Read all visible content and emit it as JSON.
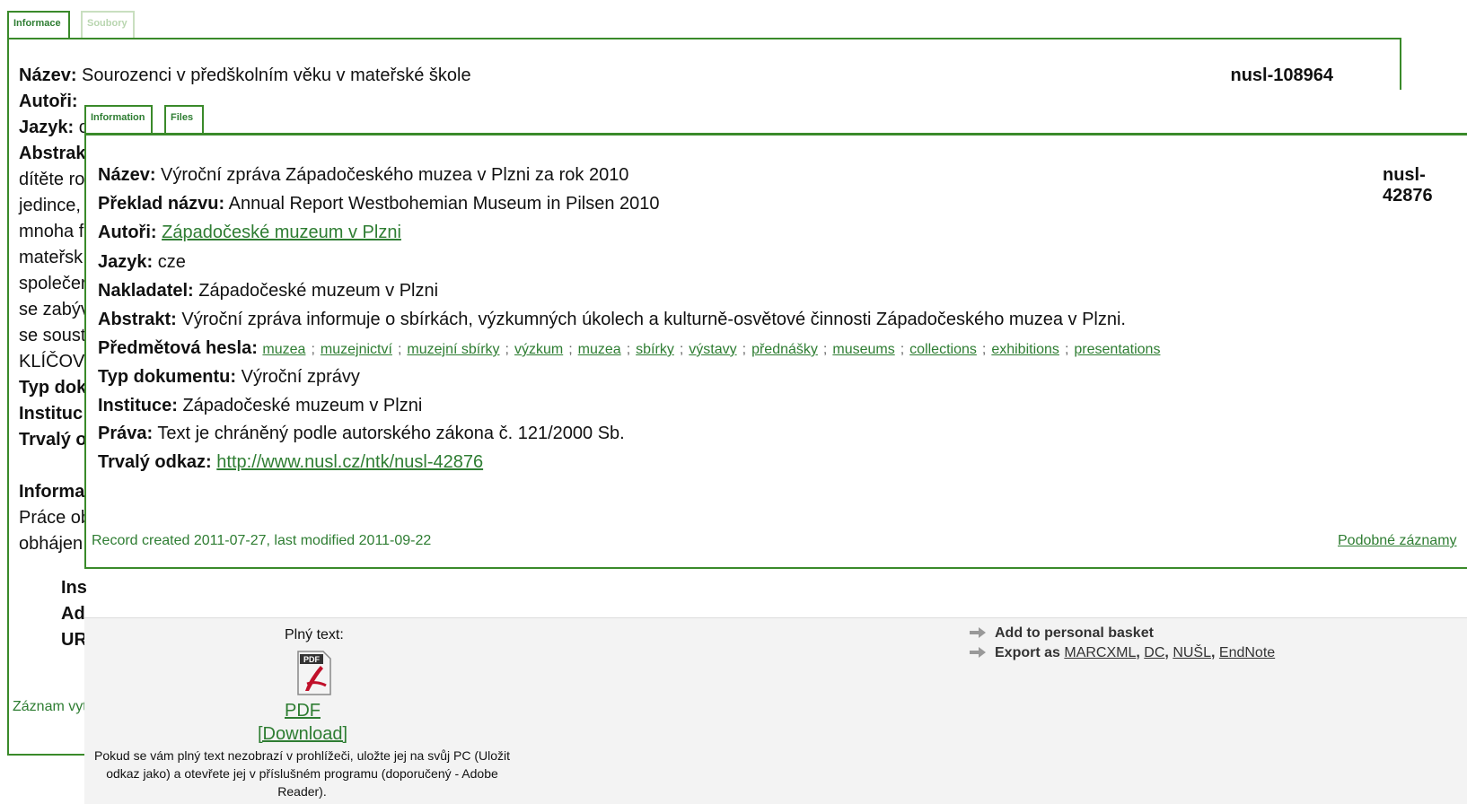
{
  "back": {
    "tabs": [
      "Informace",
      "Soubory"
    ],
    "title_label": "Název:",
    "title_value": "Sourozenci v předškolním věku v mateřské škole",
    "record_id": "nusl-108964",
    "labels": [
      "Autoři:",
      "Jazyk:",
      "Abstrak"
    ],
    "language_fragment": "c",
    "abstract_fragments": [
      "dítěte ro",
      "jedince,",
      "mnoha f",
      "mateřsk",
      "společer",
      "se zabýv",
      "se soust",
      "KLÍČOV"
    ],
    "meta_fragments": [
      "Typ dok",
      "Instituc",
      "Trvalý o"
    ],
    "info_heading": "Informa",
    "info_fragments": [
      "Práce ob",
      "obhájen"
    ],
    "sub_fragments": [
      "Ins",
      "Ad",
      "UR"
    ],
    "footer_fragment": "Záznam vyt"
  },
  "front": {
    "tabs": [
      "Information",
      "Files"
    ],
    "record_id": "nusl-42876",
    "title_label": "Název:",
    "title_value": "Výroční zpráva Západočeského muzea v Plzni za rok 2010",
    "translated_label": "Překlad názvu:",
    "translated_value": "Annual Report Westbohemian Museum in Pilsen 2010",
    "authors_label": "Autoři:",
    "authors_value": "Západočeské muzeum v Plzni",
    "language_label": "Jazyk:",
    "language_value": "cze",
    "publisher_label": "Nakladatel:",
    "publisher_value": "Západočeské muzeum v Plzni",
    "abstract_label": "Abstrakt:",
    "abstract_value": "Výroční zpráva informuje o sbírkách, výzkumných úkolech a kulturně-osvětové činnosti Západočeského muzea v Plzni.",
    "keywords_label": "Předmětová hesla:",
    "keywords": [
      "muzea",
      "muzejnictví",
      "muzejní sbírky",
      "výzkum",
      "muzea",
      "sbírky",
      "výstavy",
      "přednášky",
      "museums",
      "collections",
      "exhibitions",
      "presentations"
    ],
    "keyword_separator": ";",
    "doctype_label": "Typ dokumentu:",
    "doctype_value": "Výroční zprávy",
    "institution_label": "Instituce:",
    "institution_value": "Západočeské muzeum v Plzni",
    "rights_label": "Práva:",
    "rights_value": "Text je chráněný podle autorského zákona č. 121/2000 Sb.",
    "permalink_label": "Trvalý odkaz:",
    "permalink_value": "http://www.nusl.cz/ntk/nusl-42876",
    "record_info": "Record created 2011-07-27, last modified 2011-09-22",
    "similar_link": "Podobné záznamy"
  },
  "lower": {
    "fulltext_label": "Plný text:",
    "pdf_icon_text": "PDF",
    "pdf_link": "PDF",
    "download_link": "[Download]",
    "note": "Pokud se vám plný text nezobrazí v prohlížeči, uložte jej na svůj PC (Uložit odkaz jako) a otevřete jej v příslušném programu (doporučený - Adobe Reader).",
    "basket_label": "Add to personal basket",
    "export_label": "Export as",
    "export_formats": [
      "MARCXML",
      "DC",
      "NUŠL",
      "EndNote"
    ],
    "export_separator": ","
  },
  "colors": {
    "accent": "#2e7d32",
    "border": "#3a8a2a"
  }
}
